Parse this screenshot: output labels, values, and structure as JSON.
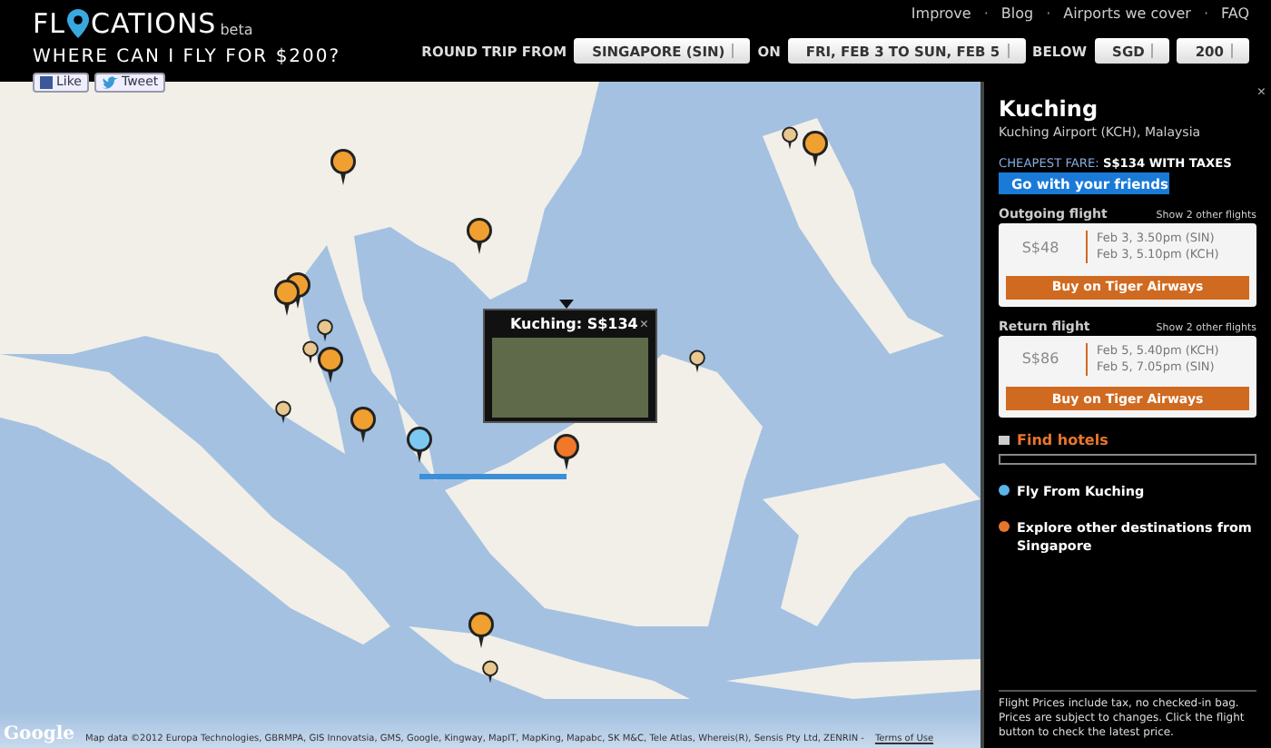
{
  "header": {
    "logo_start": "FL",
    "logo_end": "CATIONS",
    "logo_badge": "beta",
    "tagline": "WHERE CAN I FLY FOR $200?",
    "social": [
      {
        "kind": "like",
        "label": "Like"
      },
      {
        "kind": "tweet",
        "label": "Tweet"
      }
    ],
    "nav": [
      "Improve",
      "Blog",
      "Airports we cover",
      "FAQ"
    ],
    "nav_separator": "·",
    "search": [
      {
        "kind": "label",
        "text": "ROUND TRIP FROM"
      },
      {
        "kind": "select",
        "text": "SINGAPORE (SIN)"
      },
      {
        "kind": "label",
        "text": "ON"
      },
      {
        "kind": "select",
        "text": "FRI, FEB 3 TO SUN, FEB 5"
      },
      {
        "kind": "label",
        "text": "BELOW"
      },
      {
        "kind": "select",
        "text": "SGD"
      },
      {
        "kind": "select",
        "text": "200"
      }
    ]
  },
  "map": {
    "popup": {
      "title": "Kuching: S$134",
      "close": "×"
    },
    "logo": "Google",
    "attribution": "Map data ©2012 Europa Technologies, GBRMPA, GIS Innovatsia, GMS, Google, Kingway, MapIT, MapKing, Mapabc, SK M&C, Tele Atlas, Whereis(R), Sensis Pty Ltd, ZENRIN -",
    "terms": "Terms of Use"
  },
  "sidebar": {
    "close": "×",
    "city": "Kuching",
    "airport": "Kuching Airport (KCH), Malaysia",
    "fare": "CHEAPEST FARE: **S$134 WITH TAXES**",
    "friends_button": "Go with your friends",
    "flights": [
      {
        "title": "Outgoing flight",
        "more": "Show 2 other flights",
        "price": "S$48",
        "legs": [
          "Feb 3, 3.50pm (SIN)",
          "Feb 3, 5.10pm (KCH)"
        ],
        "buy": "Buy on Tiger Airways"
      },
      {
        "title": "Return flight",
        "more": "Show 2 other flights",
        "price": "S$86",
        "legs": [
          "Feb 5, 5.40pm (KCH)",
          "Feb 5, 7.05pm (SIN)"
        ],
        "buy": "Buy on Tiger Airways"
      }
    ],
    "hotels": "Find hotels",
    "links": [
      {
        "text": "Fly From Kuching",
        "color": "#5ab4e8"
      },
      {
        "text": "Explore other destinations from Singapore",
        "color": "#e8762a"
      }
    ],
    "note": "Flight Prices include tax, no checked-in bag. Prices are subject to changes. Click the flight button to check the latest price."
  }
}
